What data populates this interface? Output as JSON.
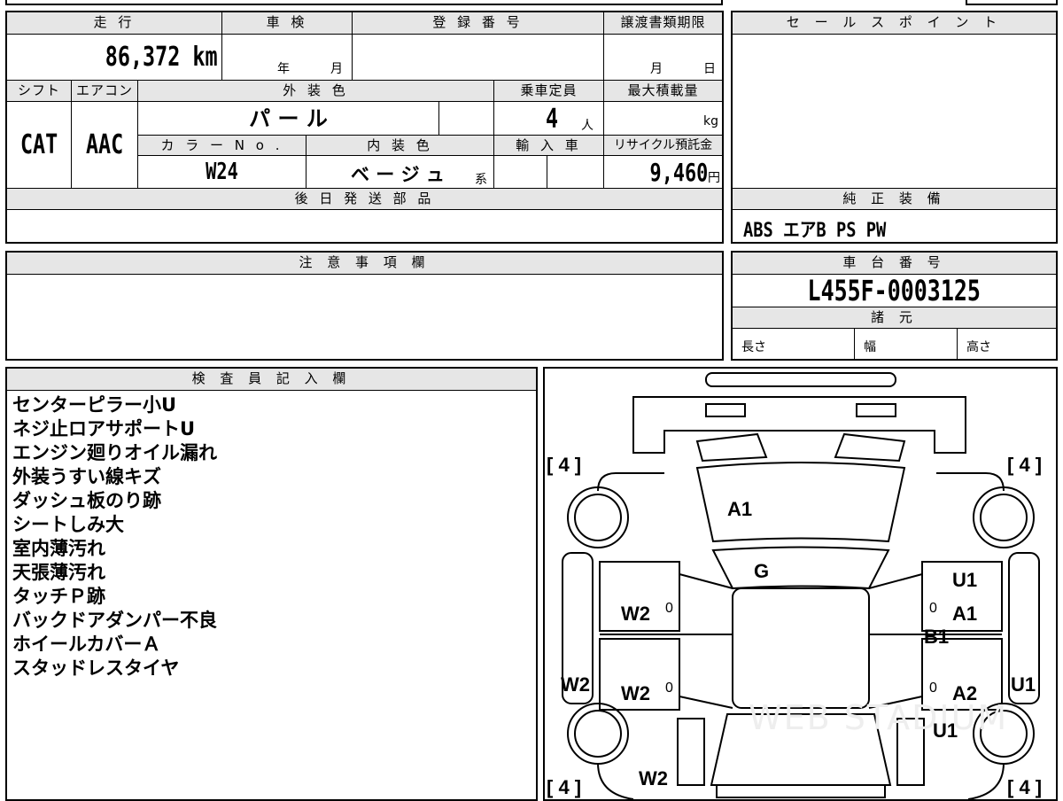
{
  "sheet": {
    "mileage_label": "走 行",
    "mileage_value": "86,372 km",
    "shaken_label": "車 検",
    "shaken_year_unit": "年",
    "shaken_month_unit": "月",
    "registration_label": "登 録 番 号",
    "transfer_deadline_label": "譲渡書類期限",
    "transfer_month_unit": "月",
    "transfer_day_unit": "日",
    "shift_label": "シフト",
    "shift_value": "CAT",
    "aircon_label": "エアコン",
    "aircon_value": "AAC",
    "exterior_color_label": "外 装 色",
    "exterior_color_value": "パ ー ル",
    "capacity_label": "乗車定員",
    "capacity_value": "4",
    "capacity_unit": "人",
    "max_load_label": "最大積載量",
    "max_load_unit": "kg",
    "color_no_label": "カ ラ ー N o .",
    "color_no_value": "W24",
    "interior_color_label": "内 装 色",
    "interior_color_value": "ベ ー ジ ュ",
    "interior_color_suffix": "系",
    "import_label": "輸 入 車",
    "recycle_label": "リサイクル預託金",
    "recycle_value": "9,460",
    "recycle_unit": "円",
    "later_parts_label": "後 日 発 送 部 品",
    "notes_label": "注 意 事 項 欄"
  },
  "sales_point": {
    "label": "セ ー ル ス ポ イ ン ト"
  },
  "equipment": {
    "label": "純 正 装 備",
    "value": "ABS エアB PS PW"
  },
  "chassis": {
    "label": "車 台 番 号",
    "value": "L455F-0003125"
  },
  "specs": {
    "label": "諸 元",
    "length_label": "長さ",
    "width_label": "幅",
    "height_label": "高さ"
  },
  "inspector": {
    "label": "検 査 員 記 入 欄",
    "notes": [
      "センターピラー小U",
      "ネジ止ロアサポートU",
      "エンジン廻りオイル漏れ",
      "外装うすい線キズ",
      "ダッシュ板のり跡",
      "シートしみ大",
      "室内薄汚れ",
      "天張薄汚れ",
      "タッチＰ跡",
      "バックドアダンパー不良",
      "ホイールカバーＡ",
      "スタッドレスタイヤ"
    ]
  },
  "diagram": {
    "tire_fl": "[ 4 ]",
    "tire_fr": "[ 4 ]",
    "tire_rl": "[ 4 ]",
    "tire_rr": "[ 4 ]",
    "hood": "A1",
    "windshield": "G",
    "left_front_door": "W2",
    "left_rear_door": "W2",
    "left_side_panel": "W2",
    "left_rear_quarter": "W2",
    "right_pillar": "U1",
    "right_front_door": "A1",
    "right_center": "B1",
    "right_rear_door": "A2",
    "right_side_panel": "U1",
    "right_rear_quarter": "U1",
    "left_front_zero": "0",
    "left_rear_zero": "0",
    "right_front_zero": "0",
    "right_rear_zero": "0",
    "watermark": "WEB STADIUM"
  }
}
